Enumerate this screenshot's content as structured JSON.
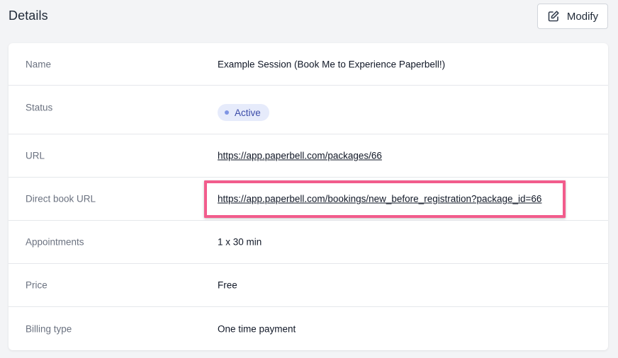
{
  "header": {
    "title": "Details",
    "modify_label": "Modify"
  },
  "details": {
    "name": {
      "label": "Name",
      "value": "Example Session (Book Me to Experience Paperbell!)"
    },
    "status": {
      "label": "Status",
      "value": "Active"
    },
    "url": {
      "label": "URL",
      "value": "https://app.paperbell.com/packages/66"
    },
    "direct_book_url": {
      "label": "Direct book URL",
      "value": "https://app.paperbell.com/bookings/new_before_registration?package_id=66"
    },
    "appointments": {
      "label": "Appointments",
      "value": "1 x 30 min"
    },
    "price": {
      "label": "Price",
      "value": "Free"
    },
    "billing_type": {
      "label": "Billing type",
      "value": "One time payment"
    }
  },
  "icons": {
    "modify": "edit-icon"
  },
  "colors": {
    "highlight": "#f25c8c",
    "badge_bg": "#e6ebfb",
    "badge_text": "#3b4ba8"
  }
}
